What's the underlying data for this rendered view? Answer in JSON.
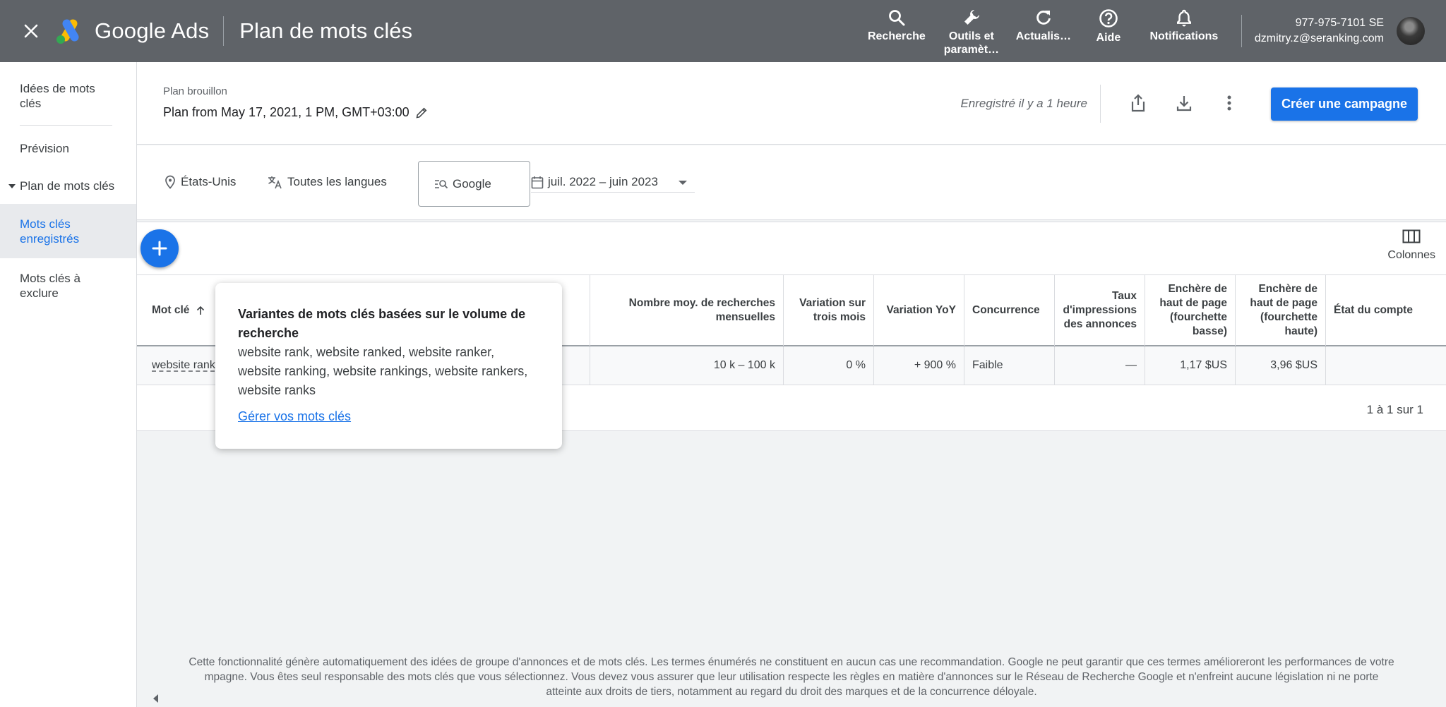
{
  "topbar": {
    "brand": "Google Ads",
    "page_title": "Plan de mots clés",
    "actions": {
      "search": "Recherche",
      "tools_line1": "Outils et",
      "tools_line2": "paramèt…",
      "refresh": "Actualis…",
      "help": "Aide",
      "notifications": "Notifications"
    },
    "account_id": "977-975-7101 SE",
    "account_email": "dzmitry.z@seranking.com"
  },
  "sidebar": {
    "items": [
      {
        "label_line1": "Idées de mots",
        "label_line2": "clés"
      },
      {
        "label": "Prévision"
      },
      {
        "label": "Plan de mots clés"
      },
      {
        "label_line1": "Mots clés",
        "label_line2": "enregistrés"
      },
      {
        "label_line1": "Mots clés à",
        "label_line2": "exclure"
      }
    ]
  },
  "header": {
    "plan_label": "Plan brouillon",
    "plan_title": "Plan from May 17, 2021, 1 PM, GMT+03:00",
    "saved_status": "Enregistré il y a 1 heure",
    "create_button": "Créer une campagne"
  },
  "filters": {
    "location": "États-Unis",
    "language": "Toutes les langues",
    "network": "Google",
    "date_range": "juil. 2022 – juin 2023"
  },
  "toolbar": {
    "columns_label": "Colonnes"
  },
  "table": {
    "headers": {
      "keyword": "Mot clé",
      "avg_searches_l1": "Nombre moy. de recherches",
      "avg_searches_l2": "mensuelles",
      "three_month_l1": "Variation sur",
      "three_month_l2": "trois mois",
      "yoy": "Variation YoY",
      "competition": "Concurrence",
      "impr_l1": "Taux",
      "impr_l2": "d'impressions",
      "impr_l3": "des annonces",
      "bid_low_l1": "Enchère de",
      "bid_low_l2": "haut de page",
      "bid_low_l3": "(fourchette",
      "bid_low_l4": "basse)",
      "bid_high_l1": "Enchère de",
      "bid_high_l2": "haut de page",
      "bid_high_l3": "(fourchette",
      "bid_high_l4": "haute)",
      "account_status": "État du compte"
    },
    "rows": [
      {
        "keyword": "website rank",
        "avg_searches": "10 k – 100 k",
        "three_month": "0 %",
        "yoy": "+ 900 %",
        "competition": "Faible",
        "impr_share": "—",
        "bid_low": "1,17 $US",
        "bid_high": "3,96 $US",
        "account_status": ""
      }
    ],
    "pagination": "1 à 1 sur 1"
  },
  "tooltip": {
    "title": "Variantes de mots clés basées sur le volume de recherche",
    "body": "website rank, website ranked, website ranker, website ranking, website rankings, website rankers, website ranks",
    "link": "Gérer vos mots clés"
  },
  "footer": {
    "disclaimer_l1": "Cette fonctionnalité génère automatiquement des idées de groupe d'annonces et de mots clés. Les termes énumérés ne constituent en aucun cas une recommandation. Google ne peut garantir que ces termes amélioreront les performances de votre",
    "disclaimer_l2": "mpagne. Vous êtes seul responsable des mots clés que vous sélectionnez. Vous devez vous assurer que leur utilisation respecte les règles en matière d'annonces sur le Réseau de Recherche Google et n'enfreint aucune législation ni ne porte",
    "disclaimer_l3": "atteinte aux droits de tiers, notamment au regard du droit des marques et de la concurrence déloyale."
  },
  "colors": {
    "topbar_bg": "#5f6368",
    "accent": "#1a73e8",
    "page_bg": "#f1f3f4"
  },
  "icons": [
    "close-icon",
    "google-ads-logo",
    "search-icon",
    "wrench-icon",
    "refresh-icon",
    "help-icon",
    "bell-icon",
    "share-icon",
    "download-icon",
    "more-vert-icon",
    "pencil-icon",
    "location-pin-icon",
    "translate-icon",
    "network-search-icon",
    "calendar-icon",
    "dropdown-arrow-icon",
    "plus-icon",
    "columns-icon",
    "sort-arrow-up-icon",
    "chevron-left-icon"
  ]
}
